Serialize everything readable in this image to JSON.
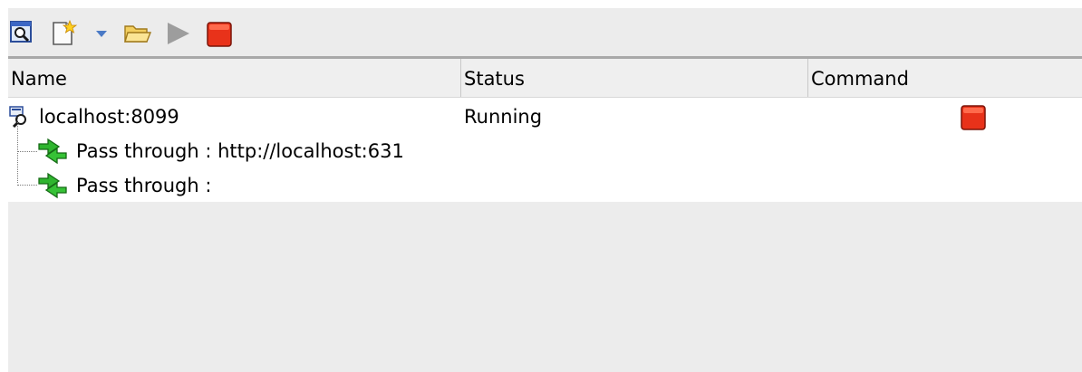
{
  "toolbar": {
    "buttons": [
      {
        "name": "inspect-icon"
      },
      {
        "name": "new-icon"
      },
      {
        "name": "dropdown-arrow-icon"
      },
      {
        "name": "open-folder-icon"
      },
      {
        "name": "run-icon"
      },
      {
        "name": "stop-icon"
      }
    ]
  },
  "table": {
    "columns": [
      "Name",
      "Status",
      "Command"
    ],
    "rows": [
      {
        "name": "localhost:8099",
        "status": "Running",
        "command_icon": "stop-icon"
      },
      {
        "name": "Pass through : http://localhost:631",
        "status": ""
      },
      {
        "name": "Pass through :",
        "status": ""
      }
    ]
  },
  "colors": {
    "stop_red": "#e8321a",
    "pass_green": "#2fb52f",
    "panel_bg": "#ececec",
    "header_bg": "#efefef"
  }
}
